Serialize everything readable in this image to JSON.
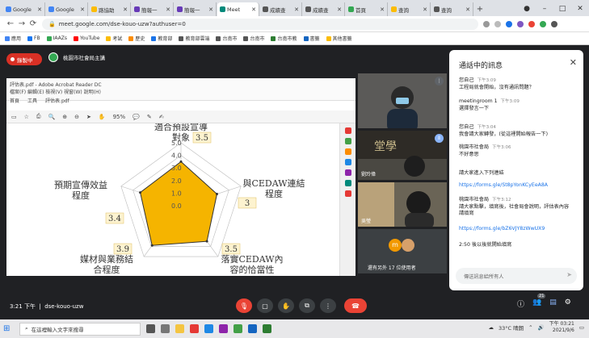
{
  "browser": {
    "tabs": [
      {
        "label": "Google",
        "active": false,
        "color": "#4285f4"
      },
      {
        "label": "Google",
        "active": false,
        "color": "#4285f4"
      },
      {
        "label": "路協助",
        "active": false,
        "color": "#fbbc05"
      },
      {
        "label": "簡報一",
        "active": false,
        "color": "#673ab7"
      },
      {
        "label": "簡報一",
        "active": false,
        "color": "#673ab7"
      },
      {
        "label": "Meet",
        "active": true,
        "color": "#00897b"
      },
      {
        "label": "成績查",
        "active": false,
        "color": "#555555"
      },
      {
        "label": "成績查",
        "active": false,
        "color": "#555555"
      },
      {
        "label": "首頁",
        "active": false,
        "color": "#34a853"
      },
      {
        "label": "查詢",
        "active": false,
        "color": "#fbbc05"
      },
      {
        "label": "查詢",
        "active": false,
        "color": "#555555"
      }
    ],
    "url": "meet.google.com/dse-kouo-uzw?authuser=0",
    "bookmarks": [
      "應用",
      "FB",
      "IAAZs",
      "YouTube",
      "考試",
      "歷史",
      "教育部",
      "教育部雲端",
      "台南市",
      "台南市",
      "台南市教",
      "書籤",
      "其他書籤"
    ]
  },
  "meet": {
    "recording_label": "錄製中",
    "presenter_label": "桃園市社會局主講",
    "participants": [
      {
        "name": ""
      },
      {
        "name": "劉玲偉"
      },
      {
        "name": "吳瑩"
      },
      {
        "name": "還有另外 17 位使用者"
      }
    ],
    "more_avatar": "m",
    "meeting_code": "dse-kouo-uzw",
    "time": "3:21 下午"
  },
  "pdf": {
    "header_line1": "評估表.pdf - Adobe Acrobat Reader DC",
    "header_line2": "檔案(F) 編輯(E) 檢視(V) 視窗(W) 說明(H)",
    "tabs": [
      "首頁",
      "工具",
      "評估表.pdf"
    ],
    "zoom": "95%"
  },
  "chart_data": {
    "type": "radar",
    "axes": [
      "適合預設宣導對象",
      "與CEDAW連結程度",
      "落實CEDAW內容的恰當性",
      "媒材與業務結合程度",
      "預期宣傳效益程度"
    ],
    "values": [
      3.5,
      3,
      3.5,
      3.9,
      3.4
    ],
    "value_labels": [
      "3.5",
      "3",
      "3.5",
      "3.9",
      "3.4"
    ],
    "scale": [
      0,
      5
    ],
    "tick_labels": [
      "0.0",
      "1.0",
      "2.0",
      "3.0",
      "4.0",
      "5.0"
    ],
    "colors": {
      "fill": "#f5b400",
      "stroke": "#333333"
    }
  },
  "chat": {
    "title": "通話中的訊息",
    "messages": [
      {
        "who": "您自己",
        "time": "下午3:09",
        "text": "工程局就會開始，沒有通訊問題？"
      },
      {
        "who": "meetingroom 1",
        "time": "下午3:09",
        "text": "選擇發言一下"
      },
      {
        "who": "您自己",
        "time": "下午3:04",
        "text": "我會請大家轉發，(從這裡開始報告一下)"
      },
      {
        "who": "桃園市社會局",
        "time": "下午3:06",
        "text": "不好意思"
      },
      {
        "who": "",
        "time": "",
        "text": "請大家進入下列連結"
      },
      {
        "who": "",
        "time": "",
        "text": "https://forms.gle/St8pYonKCyEeA8A",
        "link": true
      },
      {
        "who": "桃園市社會局",
        "time": "下午3:12",
        "text": "請大家點擊，填寫後，社會局會說明，評估表內容請填寫"
      },
      {
        "who": "",
        "time": "",
        "text": "https://forms.gle/bZ6VJY8zWwUX9",
        "link": true
      },
      {
        "who": "",
        "time": "",
        "text": "2:50 後以後就開始填寫"
      }
    ],
    "input_placeholder": "傳送訊息給所有人"
  },
  "taskbar": {
    "search_placeholder": "在這裡輸入文字來搜尋",
    "weather": "33°C 晴朗",
    "time": "下午 03:21",
    "date": "2021/9/6",
    "badge": "21"
  }
}
